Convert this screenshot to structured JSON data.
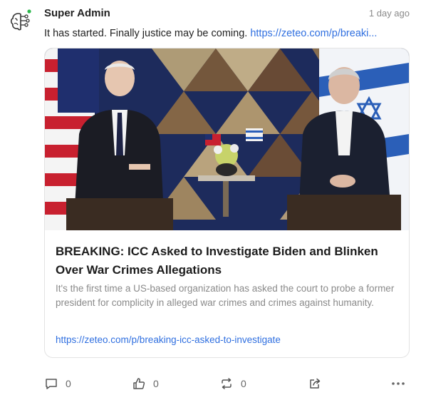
{
  "post": {
    "author": "Super Admin",
    "time": "1 day ago",
    "text": "It has started. Finally justice may be coming. ",
    "link_display": "https://zeteo.com/p/breaki...",
    "avatar_icon": "brain-circuit-icon"
  },
  "card": {
    "image_icon": "news-photo",
    "title": "BREAKING: ICC Asked to Investigate Biden and Blinken Over War Crimes Allegations",
    "description": "It's the first time a US-based organization has asked the court to probe a former president for complicity in alleged war crimes and crimes against humanity.",
    "url": "https://zeteo.com/p/breaking-icc-asked-to-investigate"
  },
  "actions": {
    "comments": "0",
    "likes": "0",
    "reposts": "0"
  },
  "colors": {
    "link": "#2f6fe0",
    "status_dot": "#2db84d"
  }
}
